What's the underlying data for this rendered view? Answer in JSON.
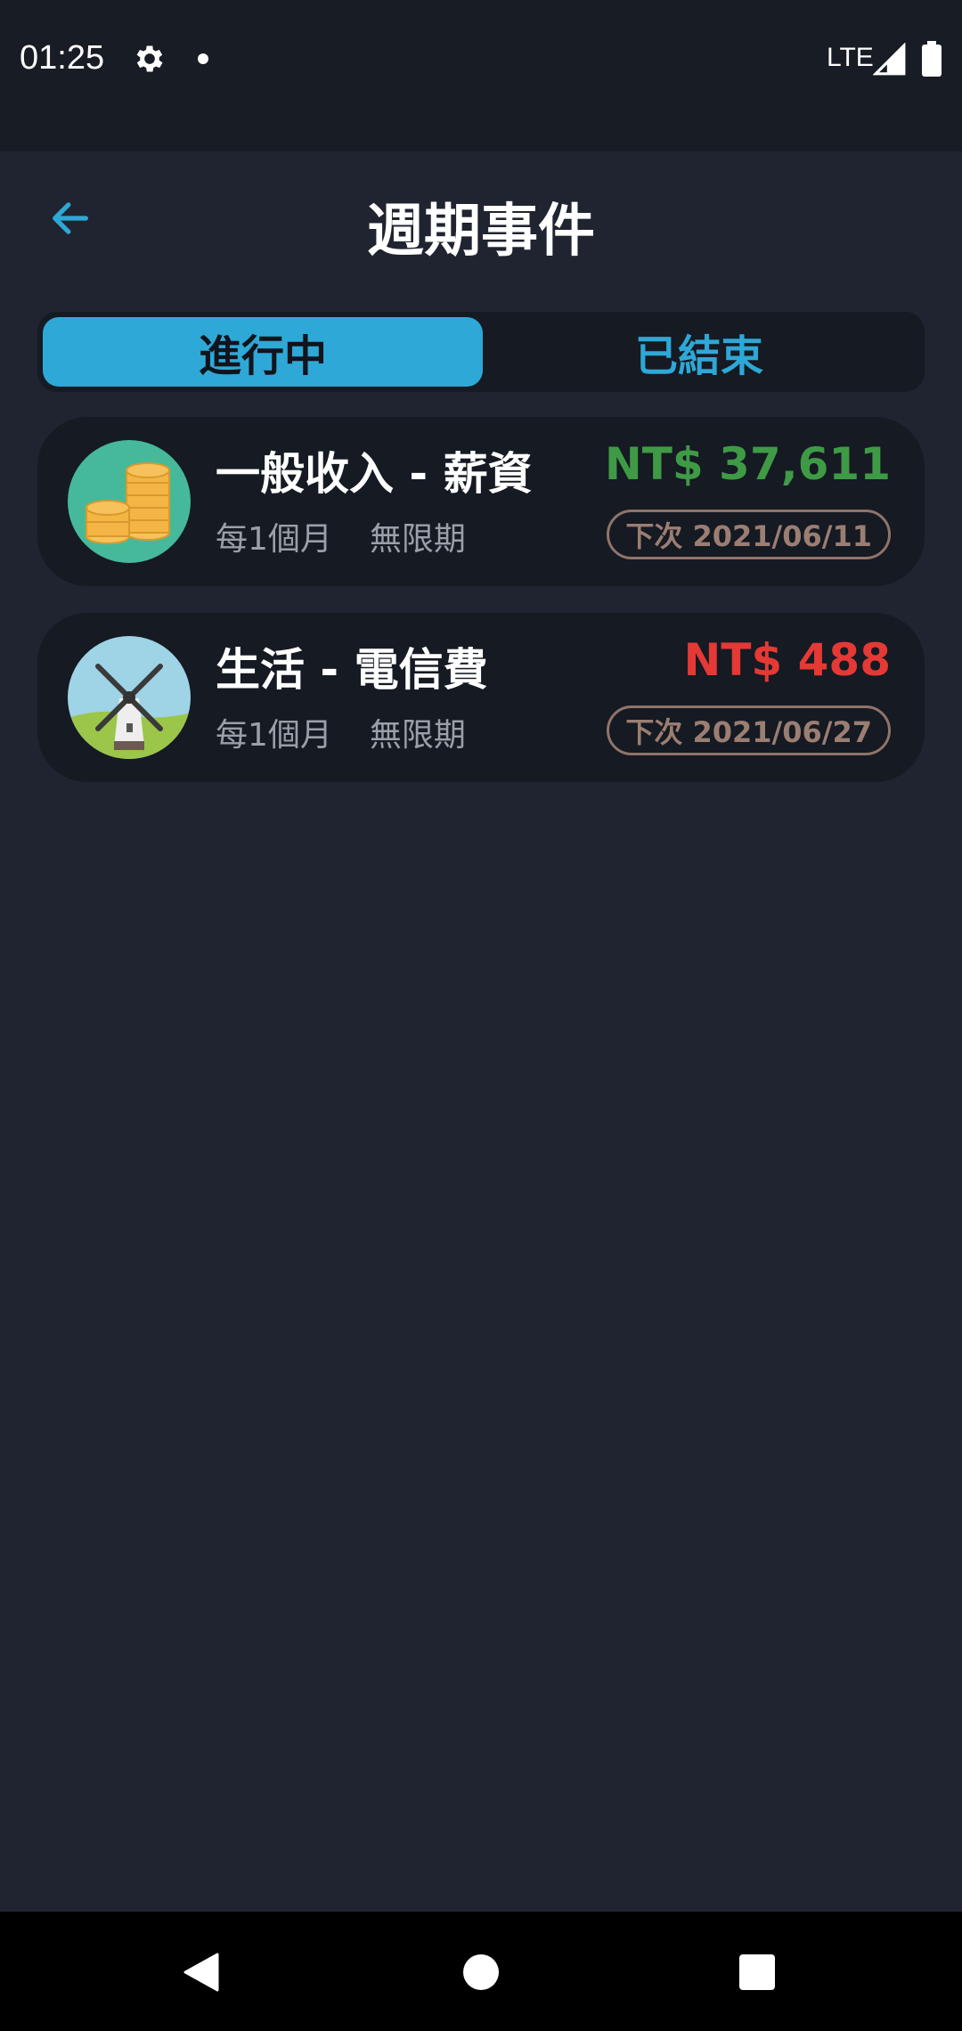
{
  "status_bar": {
    "time": "01:25",
    "network": "LTE"
  },
  "header": {
    "title": "週期事件",
    "back_icon": "arrow-left-icon"
  },
  "tabs": [
    {
      "label": "進行中",
      "active": true
    },
    {
      "label": "已結束",
      "active": false
    }
  ],
  "events": [
    {
      "title": "一般收入 - 薪資",
      "frequency": "每1個月",
      "duration": "無限期",
      "amount": "NT$ 37,611",
      "amount_color": "#3f9a45",
      "next": "下次 2021/06/11",
      "icon": "coins-icon"
    },
    {
      "title": "生活 - 電信費",
      "frequency": "每1個月",
      "duration": "無限期",
      "amount": "NT$ 488",
      "amount_color": "#e53935",
      "next": "下次 2021/06/27",
      "icon": "windmill-icon"
    }
  ],
  "colors": {
    "accent": "#2ea8d6",
    "background": "#1f2430",
    "card": "#151a23"
  }
}
